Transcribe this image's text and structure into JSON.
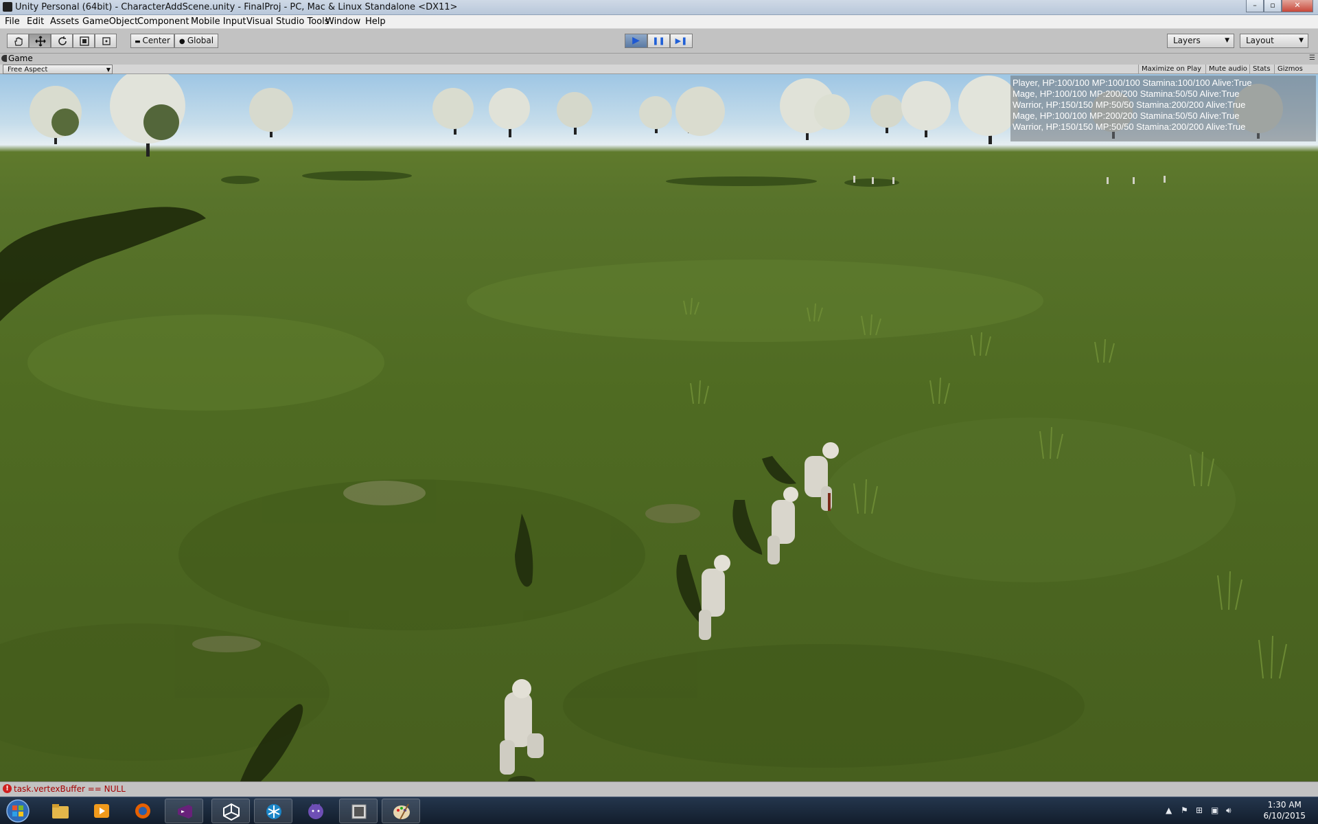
{
  "window": {
    "title": "Unity Personal (64bit) - CharacterAddScene.unity - FinalProj - PC, Mac & Linux Standalone <DX11>",
    "controls": {
      "minimize": "–",
      "maximize": "▫",
      "close": "✕"
    }
  },
  "menu": [
    "File",
    "Edit",
    "Assets",
    "GameObject",
    "Component",
    "Mobile Input",
    "Visual Studio Tools",
    "Window",
    "Help"
  ],
  "toolbar": {
    "tools": [
      "hand-tool",
      "move-tool",
      "rotate-tool",
      "scale-tool",
      "rect-tool"
    ],
    "pivot_mode": "Center",
    "pivot_rotation": "Global",
    "play": "▶",
    "pause": "❚❚",
    "step": "▶❚",
    "layers": "Layers",
    "layout": "Layout"
  },
  "game_tab": {
    "label": "Game",
    "aspect": "Free Aspect",
    "toggles": [
      "Maximize on Play",
      "Mute audio",
      "Stats",
      "Gizmos"
    ]
  },
  "stats_overlay": [
    "Player, HP:100/100 MP:100/100 Stamina:100/100 Alive:True",
    "Mage, HP:100/100 MP:200/200 Stamina:50/50 Alive:True",
    "Warrior, HP:150/150 MP:50/50 Stamina:200/200 Alive:True",
    "Mage, HP:100/100 MP:200/200 Stamina:50/50 Alive:True",
    "Warrior, HP:150/150 MP:50/50 Stamina:200/200 Alive:True"
  ],
  "console_error": "task.vertexBuffer == NULL",
  "taskbar": {
    "apps": [
      "start-orb",
      "file-explorer",
      "media-player",
      "firefox",
      "visual-studio",
      "unity",
      "app-snowflake",
      "app-cat",
      "app-window",
      "paint"
    ],
    "time": "1:30 AM",
    "date": "6/10/2015"
  },
  "colors": {
    "accent_play": "#1f5fd6",
    "error": "#a40000",
    "sky": "#c6ddeb",
    "grass": "#4f6b22"
  }
}
